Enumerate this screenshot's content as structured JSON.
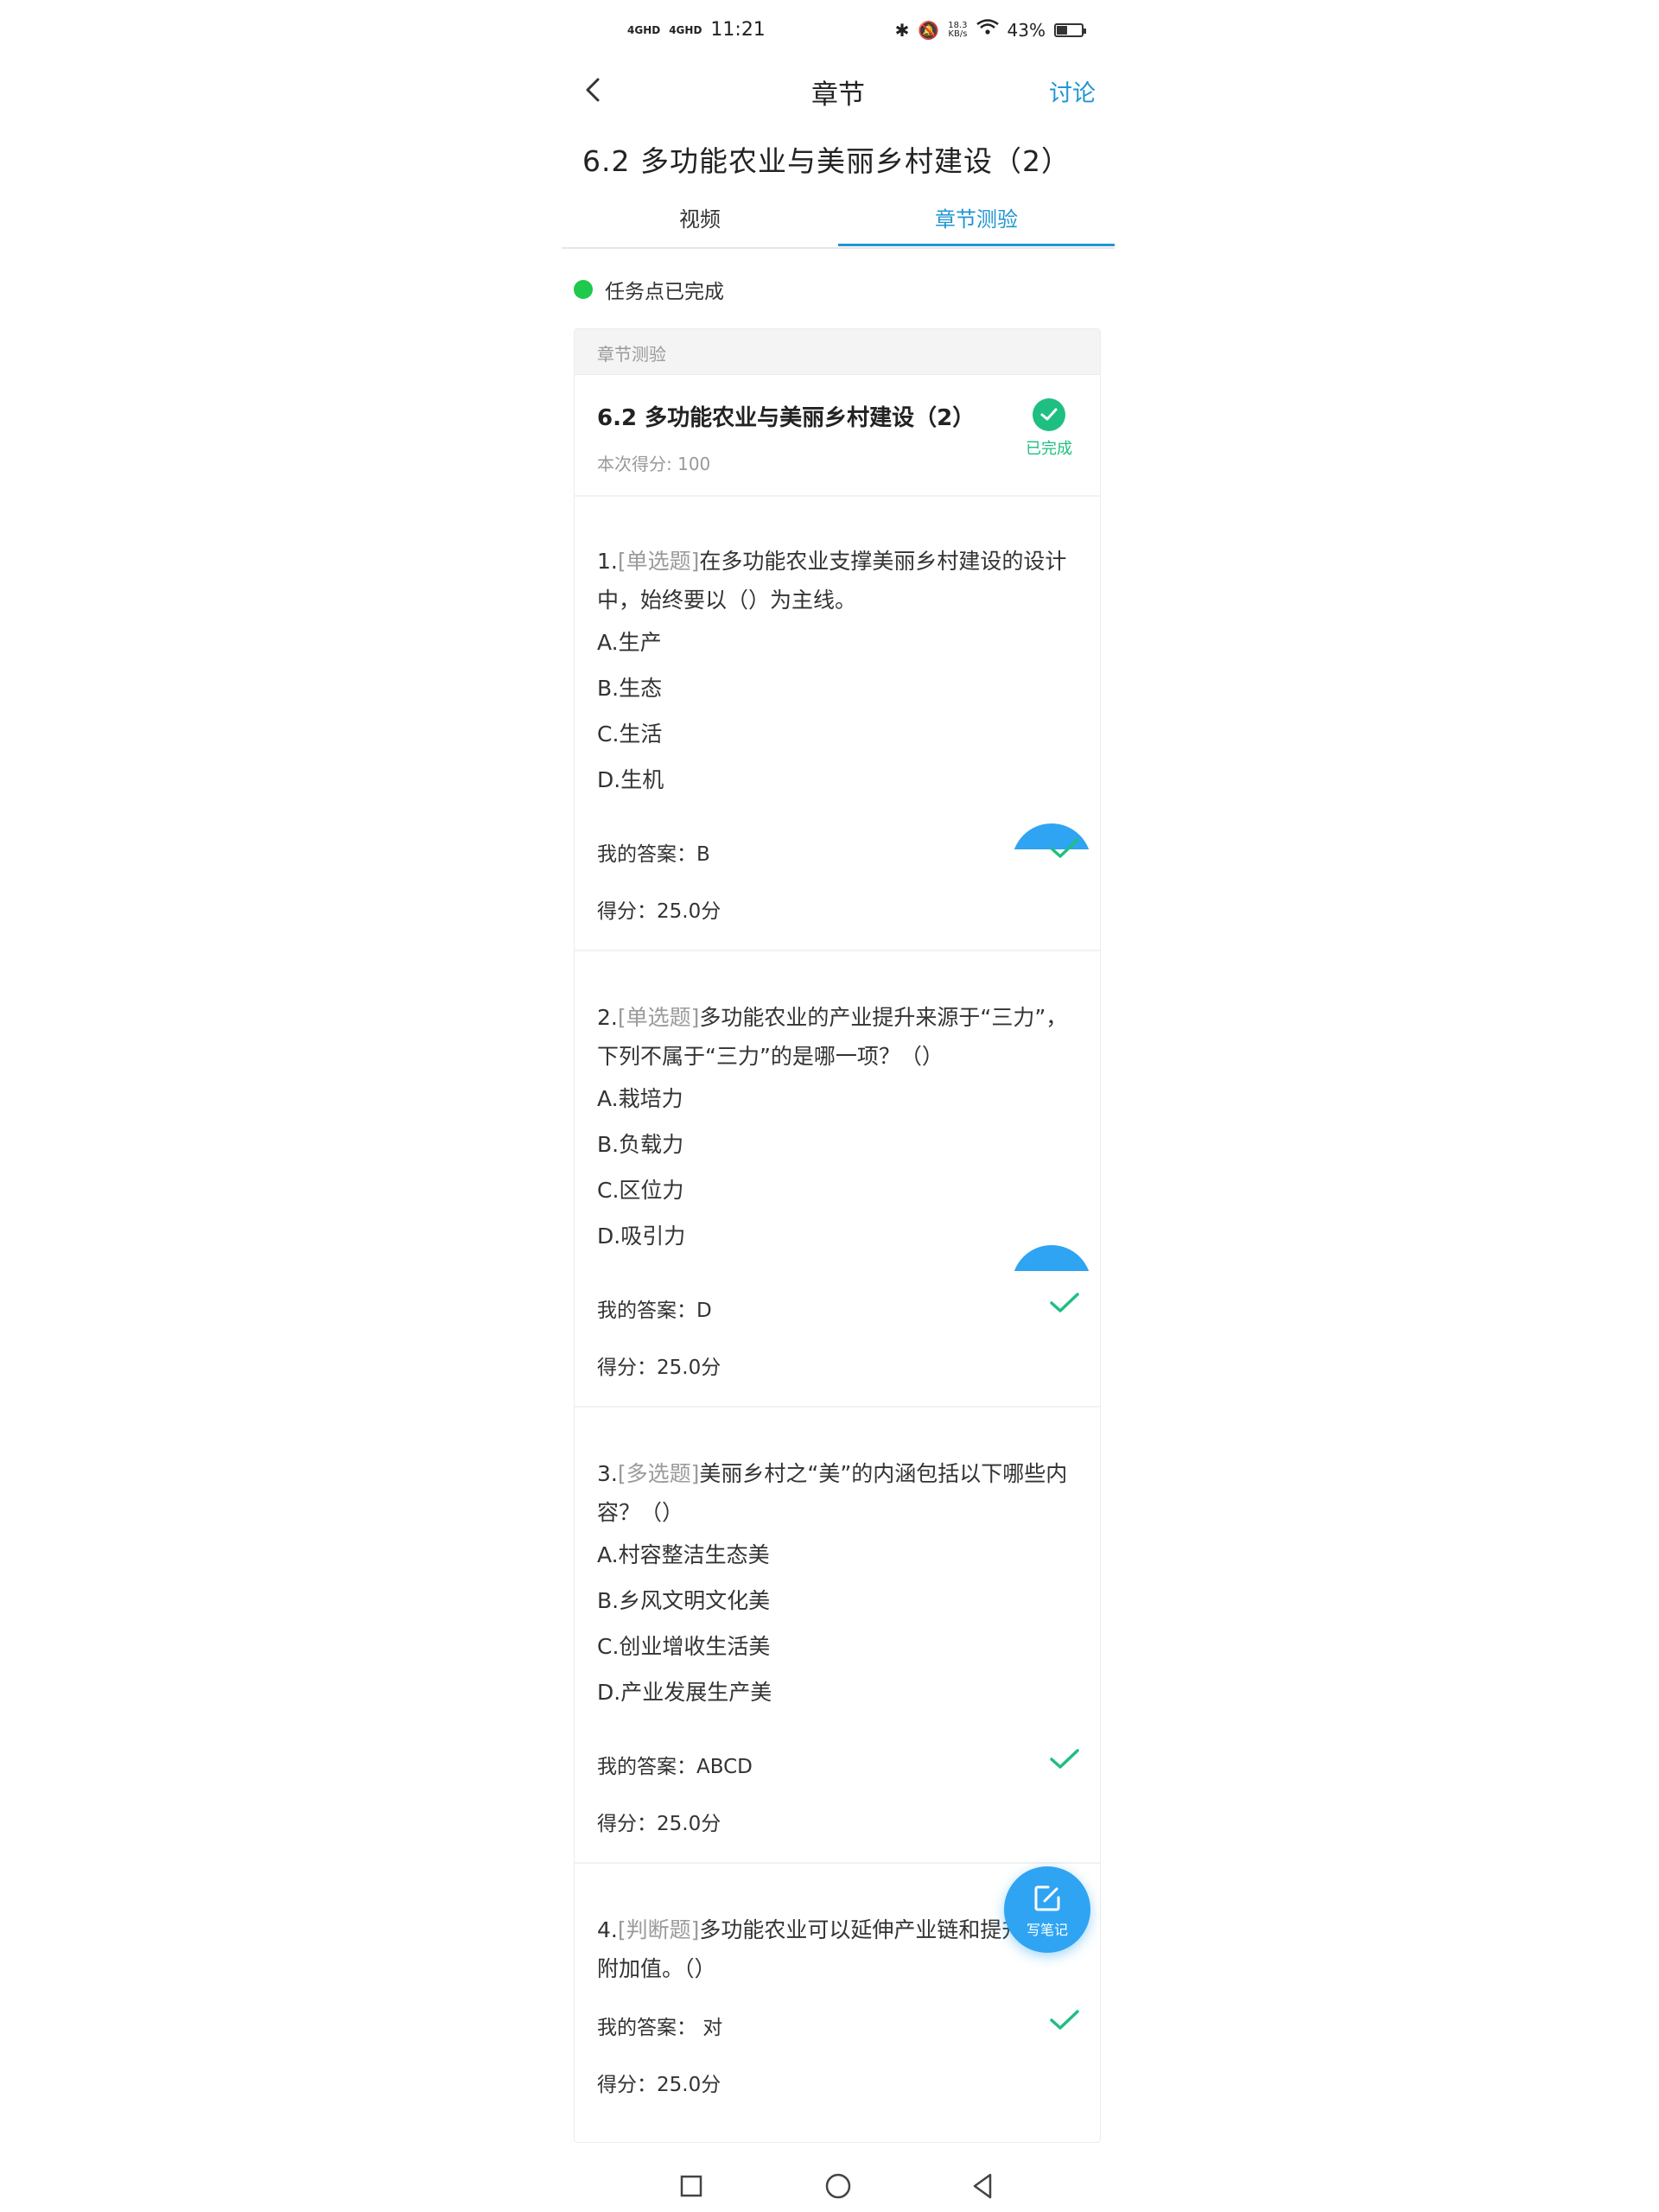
{
  "status_bar": {
    "signal_1": "4GHD",
    "signal_2": "4GHD",
    "time": "11:21",
    "speed_value": "18.3",
    "speed_unit": "KB/s",
    "battery": "43%",
    "battery_level": 0.43
  },
  "nav": {
    "title": "章节",
    "action": "讨论"
  },
  "lesson_title": "6.2  多功能农业与美丽乡村建设（2）",
  "tabs": [
    {
      "label": "视频",
      "active": false
    },
    {
      "label": "章节测验",
      "active": true
    }
  ],
  "task_status": "任务点已完成",
  "quiz": {
    "section_label": "章节测验",
    "title": "6.2 多功能农业与美丽乡村建设（2）",
    "score": "本次得分: 100",
    "status": "已完成",
    "questions": [
      {
        "number": "1.",
        "type": "[单选题]",
        "text": "在多功能农业支撑美丽乡村建设的设计中，始终要以（）为主线。",
        "options": [
          "A.生产",
          "B.生态",
          "C.生活",
          "D.生机"
        ],
        "my_answer": "我的答案：B",
        "score": "得分：25.0分"
      },
      {
        "number": "2.",
        "type": "[单选题]",
        "text": "多功能农业的产业提升来源于“三力”，下列不属于“三力”的是哪一项？（）",
        "options": [
          "A.栽培力",
          "B.负载力",
          "C.区位力",
          "D.吸引力"
        ],
        "my_answer": "我的答案：D",
        "score": "得分：25.0分"
      },
      {
        "number": "3.",
        "type": "[多选题]",
        "text": "美丽乡村之“美”的内涵包括以下哪些内容？（）",
        "options": [
          "A.村容整洁生态美",
          "B.乡风文明文化美",
          "C.创业增收生活美",
          "D.产业发展生产美"
        ],
        "my_answer": "我的答案：ABCD",
        "score": "得分：25.0分"
      },
      {
        "number": "4.",
        "type": "[判断题]",
        "text": "多功能农业可以延伸产业链和提升农业附加值。（）",
        "options": [],
        "my_answer": "我的答案： 对",
        "score": "得分：25.0分"
      }
    ]
  },
  "fab": {
    "label": "写笔记"
  },
  "colors": {
    "accent": "#2196d3",
    "success": "#1fbf82",
    "task_dot": "#1ec94c",
    "fab": "#2fa4f2"
  },
  "icons": [
    "back-icon",
    "check-icon",
    "edit-note-icon",
    "square-icon",
    "circle-icon",
    "triangle-back-icon"
  ]
}
